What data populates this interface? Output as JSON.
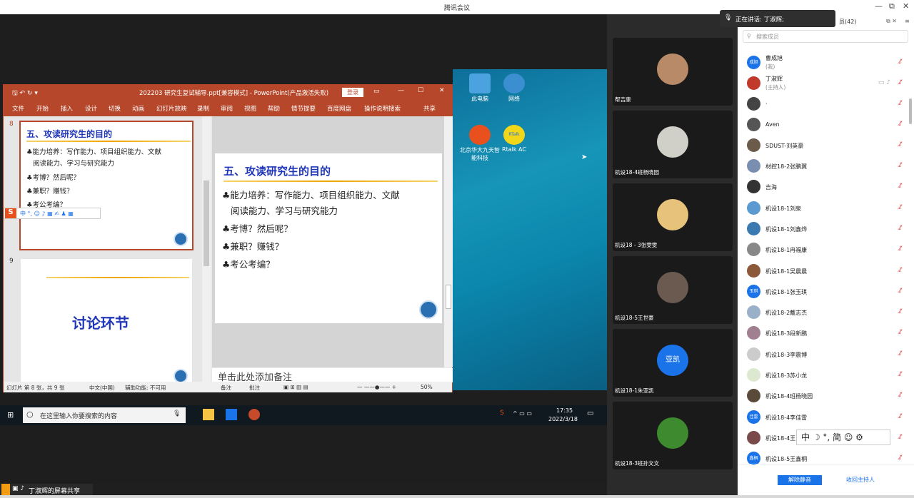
{
  "window": {
    "title": "腾讯会议",
    "minimize": "—",
    "restore": "⧉",
    "close": "✕"
  },
  "ppt": {
    "title": "202203 研究生复试辅导.ppt[兼容模式] - PowerPoint(产品激活失败)",
    "login": "登录",
    "menu": [
      "文件",
      "开始",
      "插入",
      "设计",
      "切换",
      "动画",
      "幻灯片放映",
      "录制",
      "审阅",
      "视图",
      "帮助",
      "情节提要",
      "百度网盘",
      "操作说明搜索",
      "共享"
    ],
    "slide8_number": "8",
    "slide9_number": "9",
    "slide_title": "五、攻读研究生的目的",
    "bullets": [
      "能力培养：写作能力、项目组织能力、文献",
      "阅读能力、学习与研究能力",
      "考博？然后呢？",
      "兼职？赚钱？",
      "考公考编？"
    ],
    "slide9_text": "讨论环节",
    "notes_placeholder": "单击此处添加备注",
    "status": {
      "slide_info": "幻灯片 第 8 张，共 9 张",
      "lang": "中文(中国)",
      "access": "辅助功能: 不可用",
      "notes": "备注",
      "comments": "批注",
      "zoom": "50%"
    }
  },
  "desktop": {
    "icons": [
      "此电脑",
      "网络",
      "北京华大九天智能科技",
      "Rtalk AC"
    ],
    "rtalk_badge": "RTalk"
  },
  "taskbar": {
    "search_placeholder": "在这里输入你要搜索的内容",
    "time": "17:35",
    "date": "2022/3/18"
  },
  "banner": {
    "text": "丁淑辉的屏幕共享"
  },
  "speaking": {
    "label": "正在讲话: 丁淑辉;"
  },
  "members_panel": {
    "count_label": "员(42)",
    "search_placeholder": "搜索成员",
    "unmute_all": "解除静音",
    "reclaim_host": "收回主持人"
  },
  "ime_bar": {
    "text": "中 ☽ °, 简 ☺ ⚙"
  },
  "videos": [
    {
      "name": "帮吉康",
      "avatar_color": "#b88a68"
    },
    {
      "name": "机设18-4班杨晓园",
      "avatar_color": "#d0d0c8"
    },
    {
      "name": "机设18 - 3张雯雯",
      "avatar_color": "#e6c27a"
    },
    {
      "name": "机设18-5王世豪",
      "avatar_color": "#6a5a50"
    },
    {
      "name": "机设18-1朱亚凯",
      "avatar_text": "亚凯",
      "avatar_color": "#1a73e8"
    },
    {
      "name": "机设18-3班孙文文",
      "avatar_color": "#3e8a2e"
    }
  ],
  "members": [
    {
      "name": "曹成旭",
      "sub": "(我)",
      "avatar_text": "成旭",
      "color": "#1a73e8"
    },
    {
      "name": "丁淑辉",
      "sub": "(主持人)",
      "color": "#c0392b"
    },
    {
      "name": "·",
      "color": "#444444"
    },
    {
      "name": "Aven",
      "color": "#555555"
    },
    {
      "name": "SDUST-刘英豪",
      "color": "#6b5b4b"
    },
    {
      "name": "材控18-2张鹏翼",
      "color": "#7a8fb0"
    },
    {
      "name": "吉海",
      "color": "#333333"
    },
    {
      "name": "机设18-1刘泉",
      "color": "#5a9ad0"
    },
    {
      "name": "机设18-1刘鑫烨",
      "color": "#3a7ab0"
    },
    {
      "name": "机设18-1冉福康",
      "color": "#888888"
    },
    {
      "name": "机设18-1吴晨晨",
      "color": "#8a5a3a"
    },
    {
      "name": "机设18-1张玉琪",
      "avatar_text": "玉琪",
      "color": "#1a73e8"
    },
    {
      "name": "机设18-2戴志杰",
      "color": "#9ab0c8"
    },
    {
      "name": "机设18-3段新鹏",
      "color": "#a08090"
    },
    {
      "name": "机设18-3李震博",
      "color": "#cccccc"
    },
    {
      "name": "机设18-3苏小龙",
      "color": "#dde8d0"
    },
    {
      "name": "机设18-4班杨晓园",
      "color": "#5a4a3a"
    },
    {
      "name": "机设18-4李佳雷",
      "avatar_text": "佳雷",
      "color": "#1a73e8"
    },
    {
      "name": "机设18-4王",
      "color": "#7a4a4a"
    },
    {
      "name": "机设18-5王鑫桐",
      "avatar_text": "鑫桐",
      "color": "#1a73e8"
    }
  ]
}
